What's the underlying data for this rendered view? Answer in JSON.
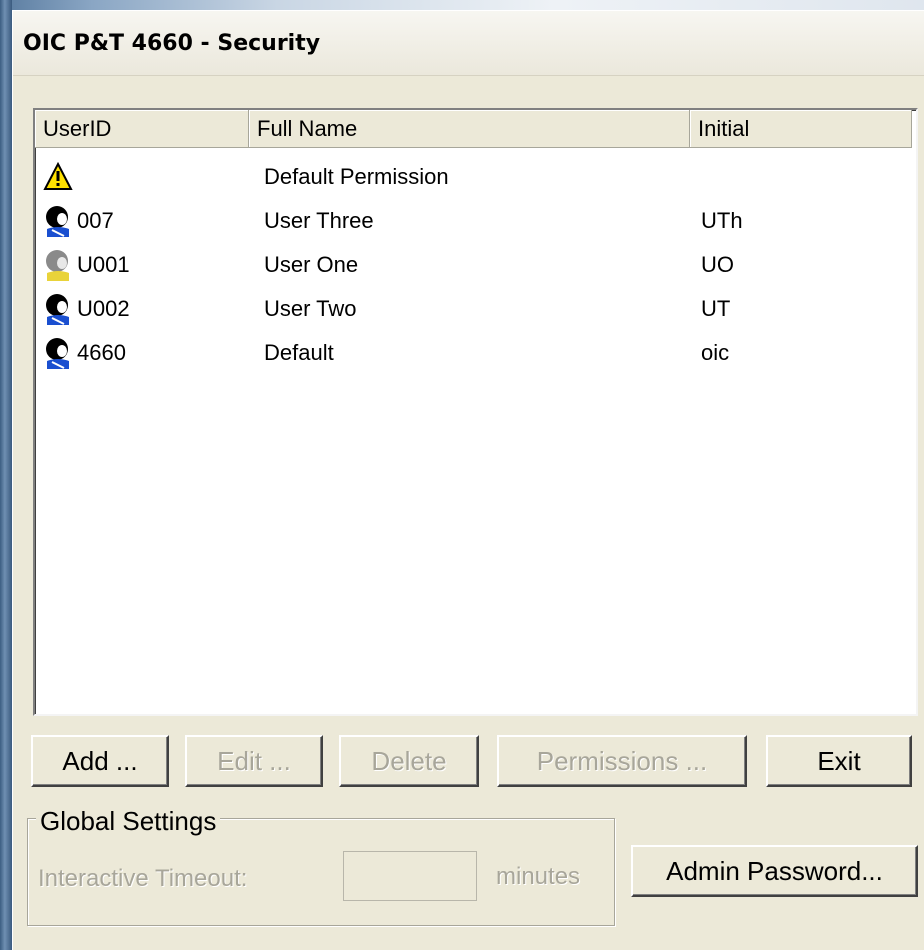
{
  "window": {
    "title": "OIC P&T 4660 - Security"
  },
  "list": {
    "columns": [
      "UserID",
      "Full Name",
      "Initial"
    ],
    "rows": [
      {
        "icon": "warning-icon",
        "userid": "",
        "full_name": "Default Permission",
        "initial": ""
      },
      {
        "icon": "user-icon",
        "userid": "007",
        "full_name": "User Three",
        "initial": "UTh"
      },
      {
        "icon": "user-disabled-icon",
        "userid": "U001",
        "full_name": "User One",
        "initial": "UO"
      },
      {
        "icon": "user-icon",
        "userid": "U002",
        "full_name": "User Two",
        "initial": "UT"
      },
      {
        "icon": "user-icon",
        "userid": "4660",
        "full_name": "Default",
        "initial": "oic"
      }
    ]
  },
  "buttons": {
    "add": "Add ...",
    "edit": "Edit ...",
    "delete": "Delete",
    "permissions": "Permissions ...",
    "exit": "Exit",
    "admin_password": "Admin Password..."
  },
  "global_settings": {
    "title": "Global Settings",
    "timeout_label": "Interactive Timeout:",
    "timeout_value": "",
    "timeout_units": "minutes"
  },
  "colors": {
    "dialog_bg": "#ece9d8",
    "disabled_text": "#a8a69a",
    "desktop": "#2e4a66"
  }
}
